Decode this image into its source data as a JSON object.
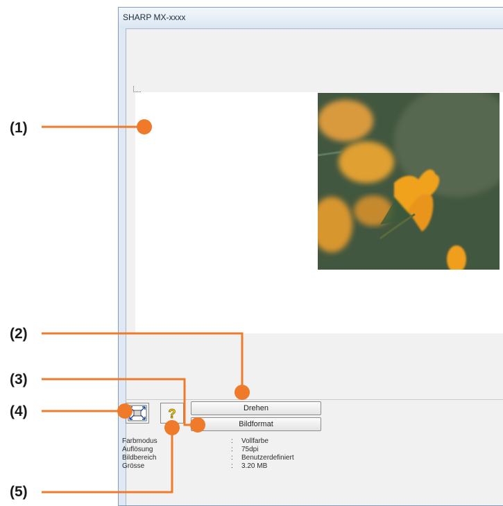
{
  "window": {
    "title": "SHARP MX-xxxx"
  },
  "callouts": [
    "(1)",
    "(2)",
    "(3)",
    "(4)",
    "(5)"
  ],
  "buttons": {
    "rotate": "Drehen",
    "image_size": "Bildformat"
  },
  "icons": {
    "zoom": "zoom-icon",
    "help": "help-icon",
    "corner": "corner-triangle-icon"
  },
  "info": [
    {
      "label": "Farbmodus",
      "value": "Vollfarbe"
    },
    {
      "label": "Auflösung",
      "value": "75dpi"
    },
    {
      "label": "Bildbereich",
      "value": "Benutzerdefiniert"
    },
    {
      "label": "Grösse",
      "value": "3.20 MB"
    }
  ],
  "colors": {
    "callout": "#ee7a2a",
    "window_frame": "#dfe8f3"
  }
}
